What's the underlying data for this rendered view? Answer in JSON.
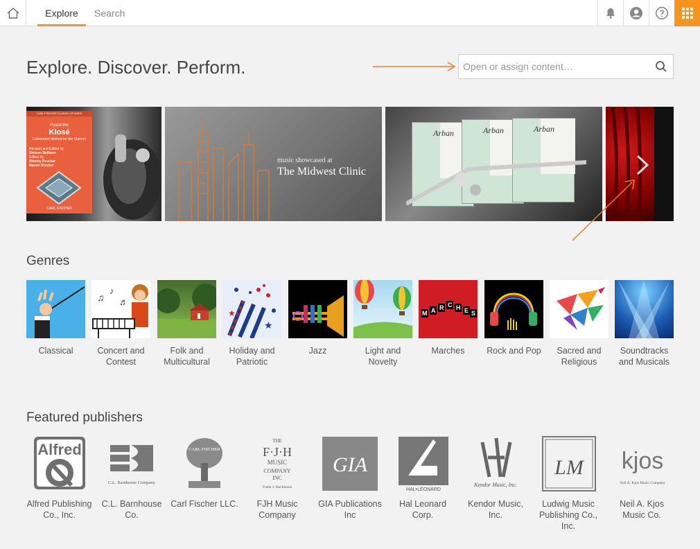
{
  "nav": {
    "tabs": [
      {
        "label": "Explore"
      },
      {
        "label": "Search"
      }
    ],
    "icons": {
      "home": "home-icon",
      "bell": "bell-icon",
      "user": "user-icon",
      "help": "help-icon",
      "apps": "apps-grid-icon"
    },
    "accent": "#f7941d"
  },
  "hero": {
    "title": "Explore. Discover. Perform.",
    "search_placeholder": "Open or assign content…"
  },
  "carousel": {
    "slides": [
      {
        "book": {
          "publisher": "CARL FISCHER CLASSIC STUDIES",
          "author": "Hyacinthe",
          "title": "Klosé",
          "subtitle": "Celebrated Method for the Clarinet",
          "editor_lines": [
            "Revised and Edited by",
            "Simeon Bellison",
            "Edited by",
            "Stanley Drucker",
            "Naomi Drucker"
          ],
          "imprint": "CARL FISCHER"
        }
      },
      {
        "line1": "music showcased at",
        "line2": "The Midwest Clinic"
      },
      {
        "book_title": "Arban"
      },
      {}
    ]
  },
  "genres": {
    "title": "Genres",
    "items": [
      {
        "label": "Classical",
        "color": "#4ab0e8"
      },
      {
        "label": "Concert and Contest",
        "color": "#ffffff"
      },
      {
        "label": "Folk and Multicultural",
        "color": "#5a8a3a"
      },
      {
        "label": "Holiday and Patriotic",
        "color": "#e8eef8"
      },
      {
        "label": "Jazz",
        "color": "#000000"
      },
      {
        "label": "Light and Novelty",
        "color": "#bfe0f0"
      },
      {
        "label": "Marches",
        "color": "#d01c24",
        "letters": [
          "M",
          "A",
          "R",
          "C",
          "H",
          "E",
          "S"
        ]
      },
      {
        "label": "Rock and Pop",
        "color": "#000000"
      },
      {
        "label": "Sacred and Religious",
        "color": "#ffffff"
      },
      {
        "label": "Soundtracks and Musicals",
        "color": "#1a5ab0"
      }
    ]
  },
  "publishers": {
    "title": "Featured publishers",
    "items": [
      {
        "label": "Alfred Publishing Co., Inc.",
        "logo_text": "Alfred"
      },
      {
        "label": "C.L. Barnhouse Co.",
        "logo_text": "C.L. Barnhouse Company"
      },
      {
        "label": "Carl Fischer LLC.",
        "logo_text": "CARL FISCHER"
      },
      {
        "label": "FJH Music Company",
        "logo_text": "THE F·J·H MUSIC COMPANY INC",
        "logo_sub": "Frank J. Hackinson"
      },
      {
        "label": "GIA Publications Inc",
        "logo_text": "GIA"
      },
      {
        "label": "Hal Leonard Corp.",
        "logo_text": "HAL•LEONARD"
      },
      {
        "label": "Kendor Music, Inc.",
        "logo_text": "Kendor Music, Inc."
      },
      {
        "label": "Ludwig Music Publishing Co., Inc.",
        "logo_text": "LM"
      },
      {
        "label": "Neil A. Kjos Music Co.",
        "logo_text": "kjos",
        "logo_sub": "Neil A. Kjos Music Company"
      }
    ]
  }
}
